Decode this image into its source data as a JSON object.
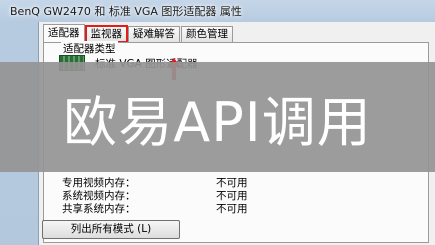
{
  "window": {
    "title": "BenQ GW2470 和 标准 VGA 图形适配器 属性"
  },
  "tabs": [
    {
      "label": "适配器"
    },
    {
      "label": "监视器"
    },
    {
      "label": "疑难解答"
    },
    {
      "label": "颜色管理"
    }
  ],
  "adapter": {
    "group_label": "适配器类型",
    "name": "标准 VGA 图形适配器",
    "icon": "graphics-card-icon"
  },
  "banner": {
    "text": "欧易API调用"
  },
  "memory": [
    {
      "label": "专用视频内存：",
      "value": "不可用"
    },
    {
      "label": "系统视频内存：",
      "value": "不可用"
    },
    {
      "label": "共享系统内存：",
      "value": "不可用"
    }
  ],
  "buttons": {
    "list_all_modes": "列出所有模式 (L)"
  },
  "colors": {
    "highlight": "#e21b1b",
    "banner": "#949494"
  }
}
